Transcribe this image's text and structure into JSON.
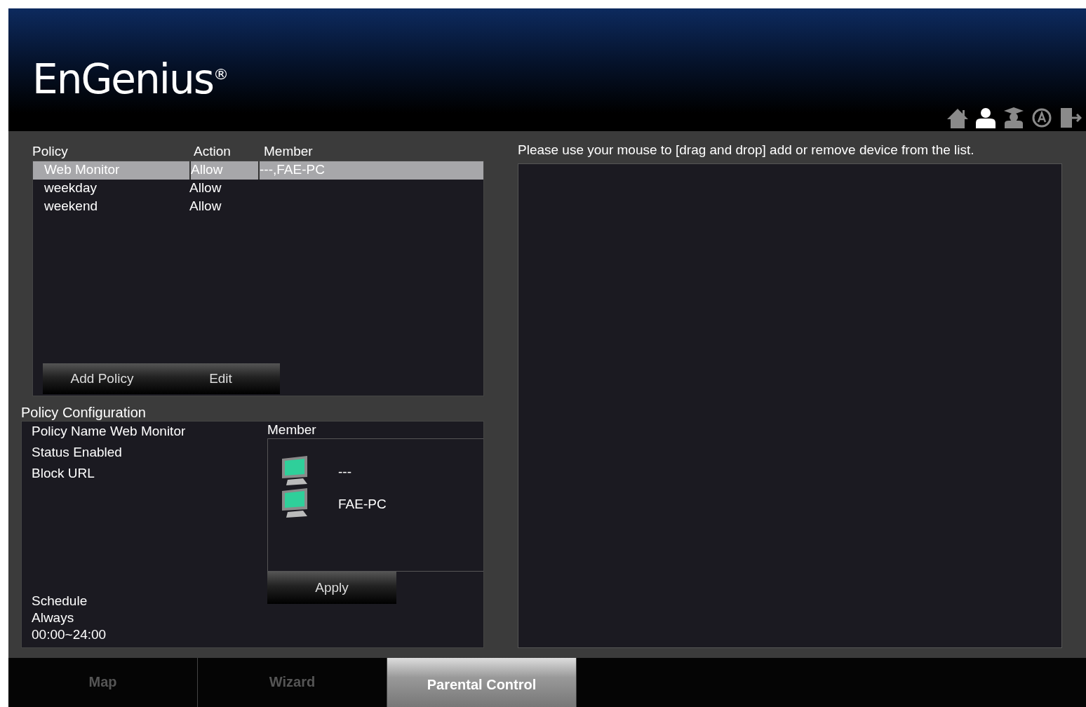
{
  "header": {
    "logo": "EnGenius",
    "logo_mark": "®",
    "nav_icons": [
      {
        "kind": "home",
        "selected": false
      },
      {
        "kind": "user",
        "selected": true
      },
      {
        "kind": "graduate",
        "selected": false
      },
      {
        "kind": "update",
        "selected": false
      },
      {
        "kind": "logout",
        "selected": false
      }
    ]
  },
  "policy_table": {
    "columns": [
      "Policy",
      "Action",
      "Member"
    ],
    "rows": [
      {
        "cells": [
          "Web Monitor",
          "Allow",
          "---,FAE-PC"
        ],
        "selected": true
      },
      {
        "cells": [
          "weekday",
          "Allow"
        ],
        "selected": false
      },
      {
        "cells": [
          "weekend",
          "Allow"
        ],
        "selected": false
      }
    ],
    "buttons": [
      "Add Policy",
      "Edit"
    ]
  },
  "policy_configuration": {
    "title": "Policy Configuration",
    "fields": [
      "Policy Name Web Monitor",
      "Status Enabled",
      "Block URL"
    ],
    "schedule": [
      "Schedule",
      "Always",
      "00:00~24:00"
    ],
    "member_label": "Member",
    "members": [
      "---",
      "FAE-PC"
    ],
    "apply": "Apply"
  },
  "device_area": {
    "instruction": "Please use your mouse to [drag and drop] add or remove device from the list."
  },
  "tabs": [
    {
      "label": "Map",
      "selected": false
    },
    {
      "label": "Wizard",
      "selected": false
    },
    {
      "label": "Parental Control",
      "selected": true
    }
  ]
}
